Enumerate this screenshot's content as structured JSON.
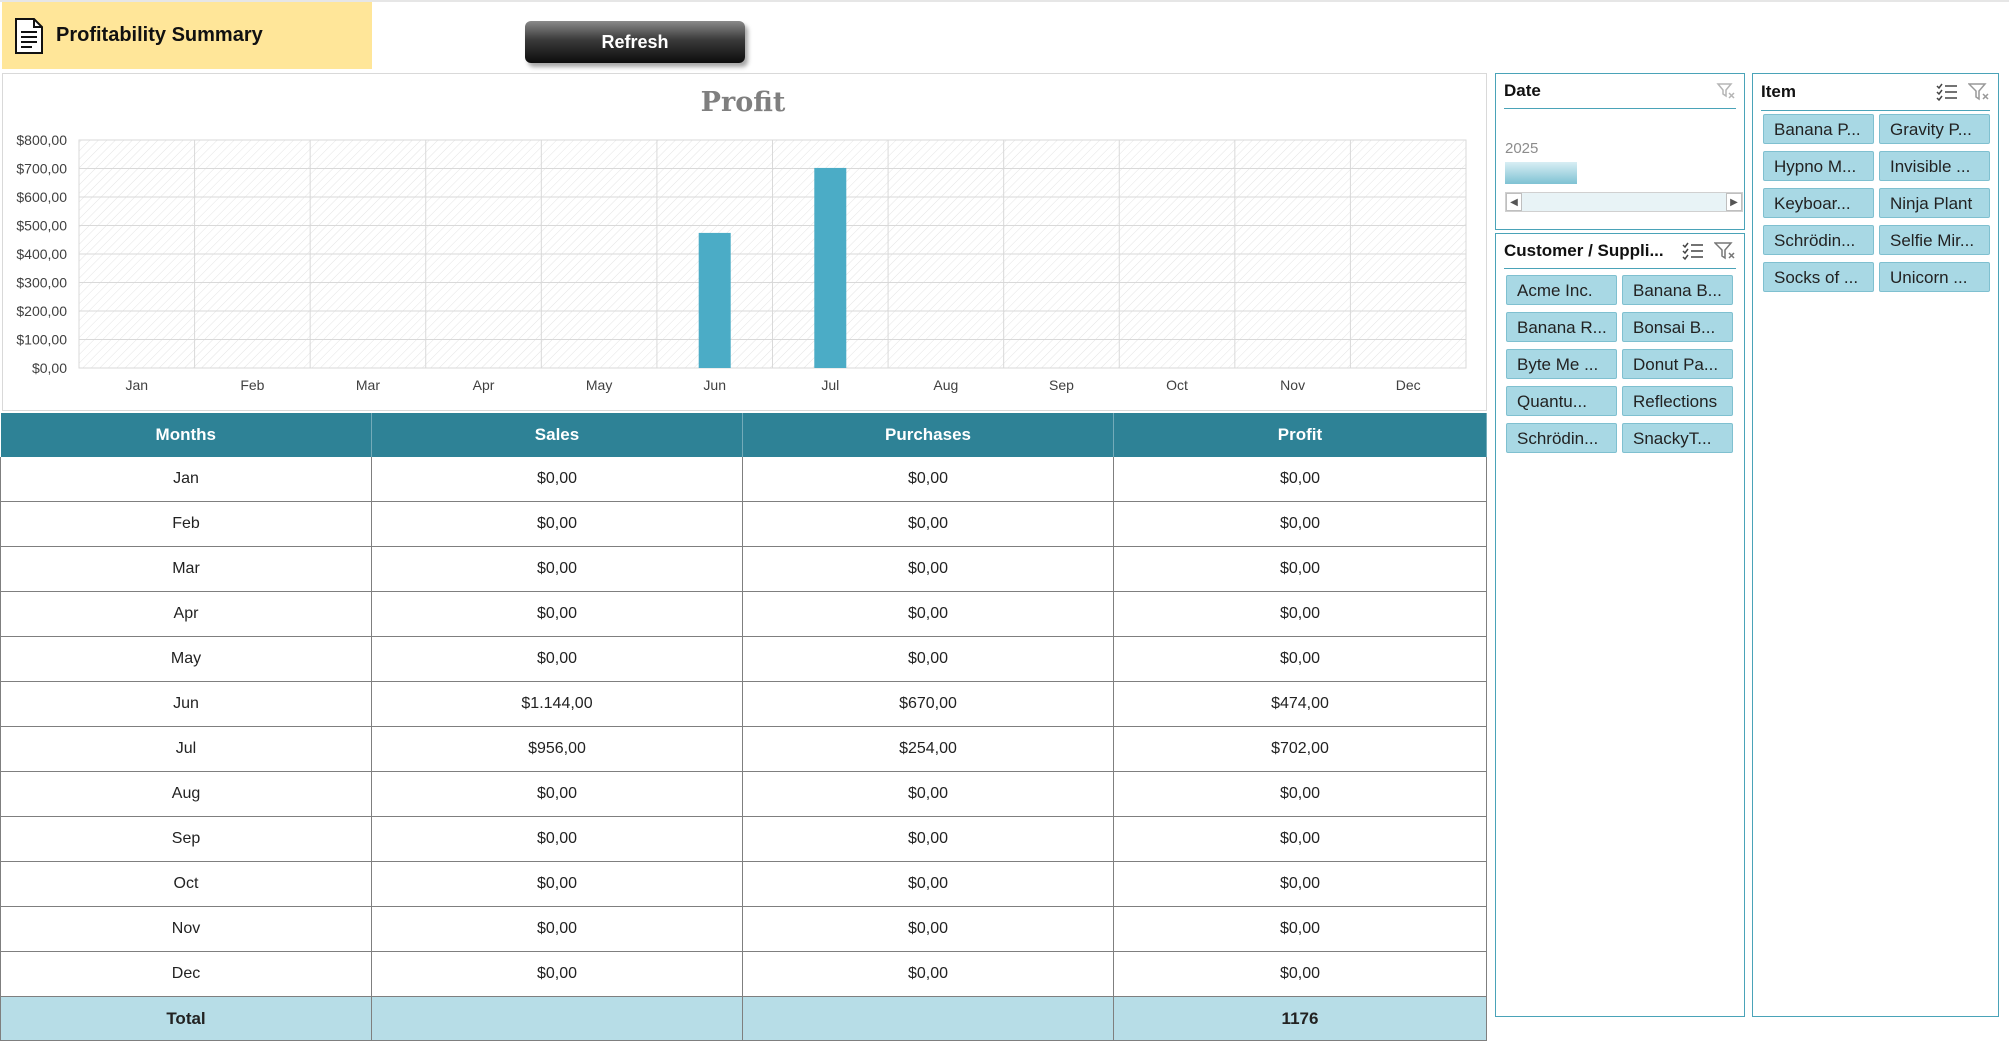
{
  "header": {
    "title": "Profitability Summary",
    "refresh_label": "Refresh"
  },
  "chart_data": {
    "type": "bar",
    "title": "Profit",
    "categories": [
      "Jan",
      "Feb",
      "Mar",
      "Apr",
      "May",
      "Jun",
      "Jul",
      "Aug",
      "Sep",
      "Oct",
      "Nov",
      "Dec"
    ],
    "values": [
      0,
      0,
      0,
      0,
      0,
      474,
      702,
      0,
      0,
      0,
      0,
      0
    ],
    "ylim": [
      0,
      800
    ],
    "yticks": [
      "$0,00",
      "$100,00",
      "$200,00",
      "$300,00",
      "$400,00",
      "$500,00",
      "$600,00",
      "$700,00",
      "$800,00"
    ],
    "grid": true,
    "bar_color": "#4bacc6"
  },
  "table": {
    "headers": [
      "Months",
      "Sales",
      "Purchases",
      "Profit"
    ],
    "rows": [
      [
        "Jan",
        "$0,00",
        "$0,00",
        "$0,00"
      ],
      [
        "Feb",
        "$0,00",
        "$0,00",
        "$0,00"
      ],
      [
        "Mar",
        "$0,00",
        "$0,00",
        "$0,00"
      ],
      [
        "Apr",
        "$0,00",
        "$0,00",
        "$0,00"
      ],
      [
        "May",
        "$0,00",
        "$0,00",
        "$0,00"
      ],
      [
        "Jun",
        "$1.144,00",
        "$670,00",
        "$474,00"
      ],
      [
        "Jul",
        "$956,00",
        "$254,00",
        "$702,00"
      ],
      [
        "Aug",
        "$0,00",
        "$0,00",
        "$0,00"
      ],
      [
        "Sep",
        "$0,00",
        "$0,00",
        "$0,00"
      ],
      [
        "Oct",
        "$0,00",
        "$0,00",
        "$0,00"
      ],
      [
        "Nov",
        "$0,00",
        "$0,00",
        "$0,00"
      ],
      [
        "Dec",
        "$0,00",
        "$0,00",
        "$0,00"
      ]
    ],
    "total": [
      "Total",
      "",
      "",
      "1176"
    ]
  },
  "date_slicer": {
    "title": "Date",
    "year": "2025"
  },
  "customer_slicer": {
    "title": "Customer / Suppli...",
    "items": [
      "Acme Inc.",
      "Banana B...",
      "Banana R...",
      "Bonsai B...",
      "Byte Me ...",
      "Donut Pa...",
      "Quantu...",
      "Reflections",
      "Schrödin...",
      "SnackyT..."
    ]
  },
  "item_slicer": {
    "title": "Item",
    "items": [
      "Banana P...",
      "Gravity P...",
      "Hypno M...",
      "Invisible ...",
      "Keyboar...",
      "Ninja Plant",
      "Schrödin...",
      "Selfie Mir...",
      "Socks of ...",
      "Unicorn ..."
    ]
  },
  "colors": {
    "header_fill": "#ffe699",
    "table_header": "#2e8296",
    "total_row": "#b7dde7",
    "slicer_item": "#a8d8e4"
  },
  "icons": [
    "document-icon",
    "clear-filter-icon",
    "multi-select-icon"
  ]
}
